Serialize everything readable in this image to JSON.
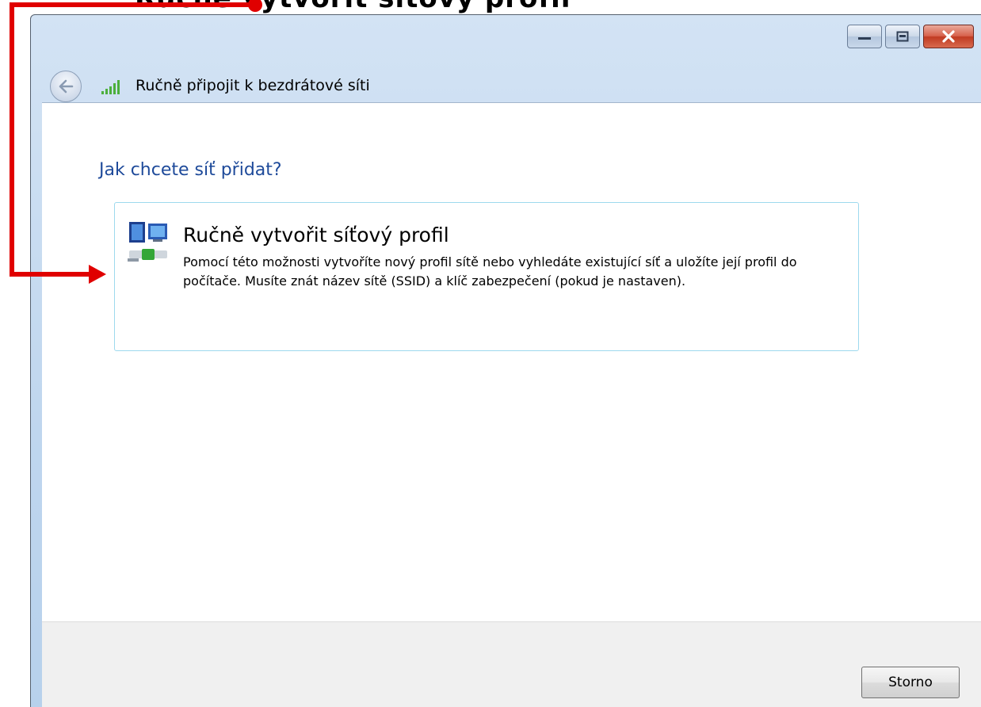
{
  "top_caption": "Ručně vytvořit síťový profil",
  "window": {
    "title": "Ručně připojit k bezdrátové síti",
    "minimize_icon": "minimize-icon",
    "maximize_icon": "maximize-icon",
    "close_icon": "close-icon"
  },
  "content": {
    "heading": "Jak chcete síť přidat?",
    "option": {
      "title": "Ručně vytvořit síťový profil",
      "description": "Pomocí této možnosti vytvoříte nový profil sítě nebo vyhledáte existující síť a uložíte její profil do počítače. Musíte znát název sítě (SSID) a klíč zabezpečení (pokud je nastaven).",
      "icon": "network-profile-icon"
    }
  },
  "footer": {
    "cancel_label": "Storno"
  },
  "colors": {
    "heading": "#1e4a9a",
    "annotation": "#e00000",
    "card_border": "#9dd9ee"
  }
}
